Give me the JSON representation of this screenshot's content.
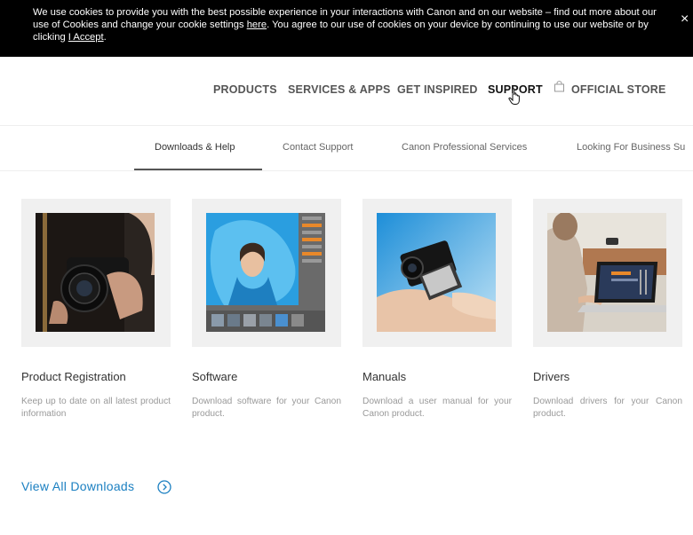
{
  "cookie_banner": {
    "text_1": "We use cookies to provide you with the best possible experience in your interactions with Canon and on our website – find out more about our use of Cookies and change your cookie settings ",
    "here_link": "here",
    "text_2": ". You agree to our use of cookies on your device by continuing to use our website or by clicking ",
    "accept_link": "I Accept",
    "text_3": ".",
    "close": "×"
  },
  "main_nav": {
    "items": [
      "PRODUCTS",
      "SERVICES & APPS",
      "GET INSPIRED",
      "SUPPORT",
      "OFFICIAL STORE"
    ]
  },
  "sub_nav": {
    "tabs": [
      "Downloads & Help",
      "Contact Support",
      "Canon Professional Services",
      "Looking For Business Su"
    ]
  },
  "cards": [
    {
      "title": "Product Registration",
      "desc": "Keep up to date on all latest product information"
    },
    {
      "title": "Software",
      "desc": "Download software for your Canon product."
    },
    {
      "title": "Manuals",
      "desc": "Download a user manual for your Canon product."
    },
    {
      "title": "Drivers",
      "desc": "Download drivers for your Canon product."
    }
  ],
  "view_all": {
    "label": "View All Downloads"
  },
  "icons": {
    "store": "shopping-bag-icon",
    "view_all": "chevron-right-circle-icon",
    "cursor": "hand-pointer-icon"
  },
  "colors": {
    "banner_bg": "#000000",
    "link": "#1a7fc1",
    "card_bg": "#f0f0f0"
  }
}
